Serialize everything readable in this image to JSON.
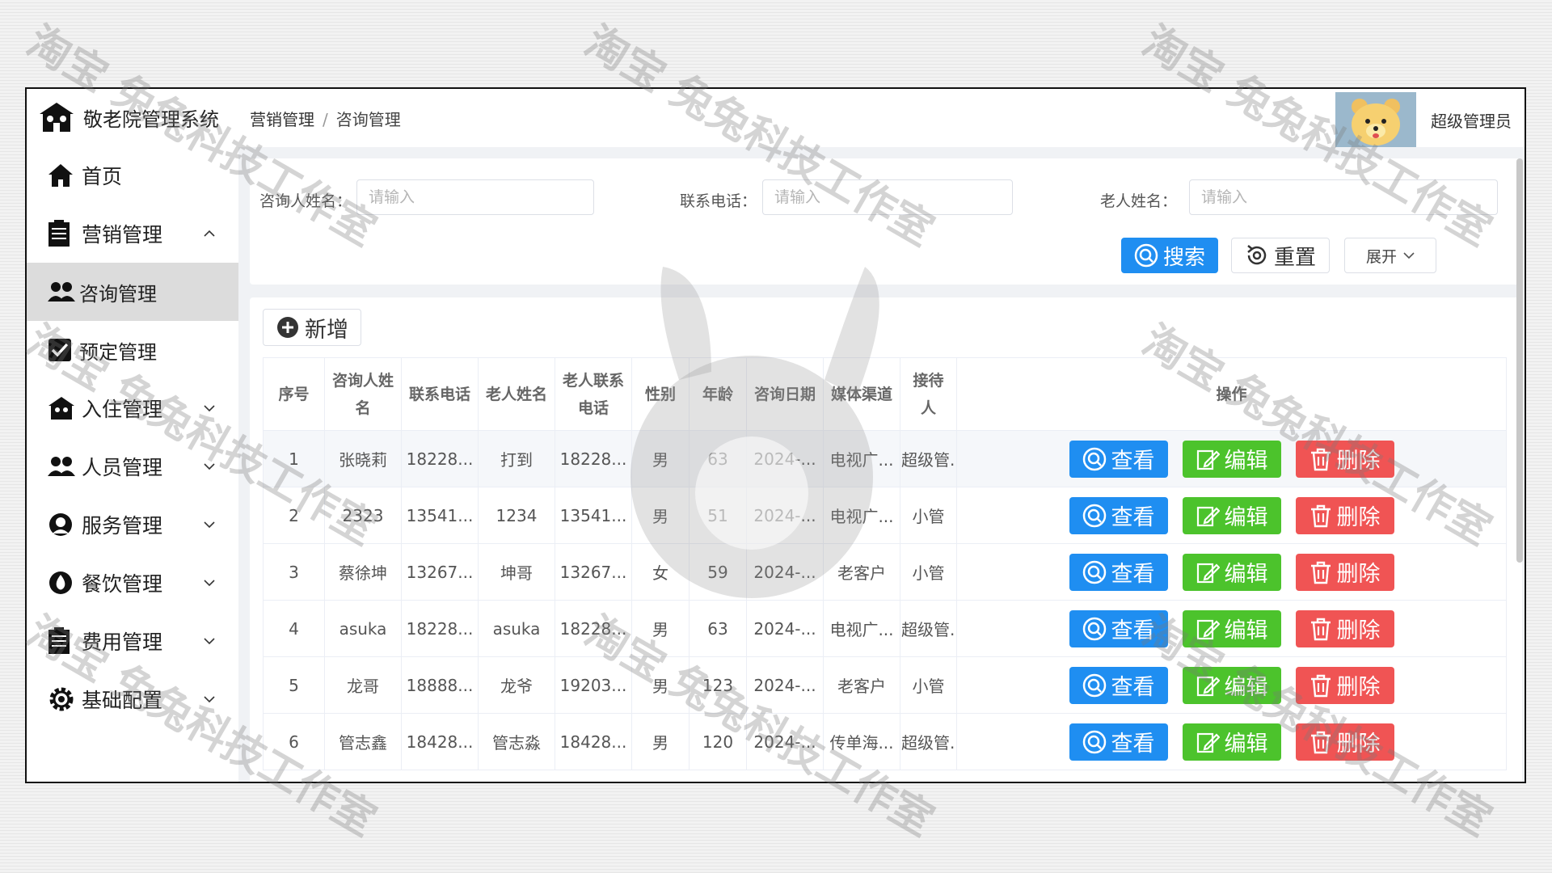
{
  "app": {
    "title": "敬老院管理系统"
  },
  "sidebar": {
    "items": [
      {
        "label": "首页",
        "icon": "home-icon"
      },
      {
        "label": "营销管理",
        "icon": "clipboard-icon",
        "expanded": true
      },
      {
        "label": "咨询管理",
        "icon": "people-icon",
        "active": true
      },
      {
        "label": "预定管理",
        "icon": "checkbox-icon"
      },
      {
        "label": "入住管理",
        "icon": "house-icon"
      },
      {
        "label": "人员管理",
        "icon": "people-icon"
      },
      {
        "label": "服务管理",
        "icon": "service-icon"
      },
      {
        "label": "餐饮管理",
        "icon": "drop-icon"
      },
      {
        "label": "费用管理",
        "icon": "clipboard-icon"
      },
      {
        "label": "基础配置",
        "icon": "gear-icon"
      }
    ]
  },
  "header": {
    "breadcrumb": [
      "营销管理",
      "咨询管理"
    ],
    "separator": "/",
    "user": "超级管理员"
  },
  "search": {
    "fields": [
      {
        "label": "咨询人姓名：",
        "placeholder": "请输入"
      },
      {
        "label": "联系电话：",
        "placeholder": "请输入"
      },
      {
        "label": "老人姓名：",
        "placeholder": "请输入"
      }
    ],
    "search_label": "搜索",
    "reset_label": "重置",
    "expand_label": "展开"
  },
  "table": {
    "add_label": "新增",
    "columns": [
      "序号",
      "咨询人姓名",
      "联系电话",
      "老人姓名",
      "老人联系电话",
      "性别",
      "年龄",
      "咨询日期",
      "媒体渠道",
      "接待人",
      "操作"
    ],
    "rows": [
      [
        "1",
        "张晓莉",
        "18228...",
        "打到",
        "18228...",
        "男",
        "63",
        "2024-...",
        "电视广...",
        "超级管..."
      ],
      [
        "2",
        "2323",
        "13541...",
        "1234",
        "13541...",
        "男",
        "51",
        "2024-...",
        "电视广...",
        "小管"
      ],
      [
        "3",
        "蔡徐坤",
        "13267...",
        "坤哥",
        "13267...",
        "女",
        "59",
        "2024-...",
        "老客户",
        "小管"
      ],
      [
        "4",
        "asuka",
        "18228...",
        "asuka",
        "18228...",
        "男",
        "63",
        "2024-...",
        "电视广...",
        "超级管..."
      ],
      [
        "5",
        "龙哥",
        "18888...",
        "龙爷",
        "19203...",
        "男",
        "123",
        "2024-...",
        "老客户",
        "小管"
      ],
      [
        "6",
        "管志鑫",
        "18428...",
        "管志淼",
        "18428...",
        "男",
        "120",
        "2024-...",
        "传单海...",
        "超级管..."
      ]
    ],
    "actions": {
      "view": "查看",
      "edit": "编辑",
      "delete": "删除"
    }
  },
  "watermark": "淘宝 兔兔科技工作室",
  "colors": {
    "primary": "#1f8ef1",
    "success": "#4cc32c",
    "danger": "#f05454",
    "active_bg": "#dcdcdc"
  }
}
